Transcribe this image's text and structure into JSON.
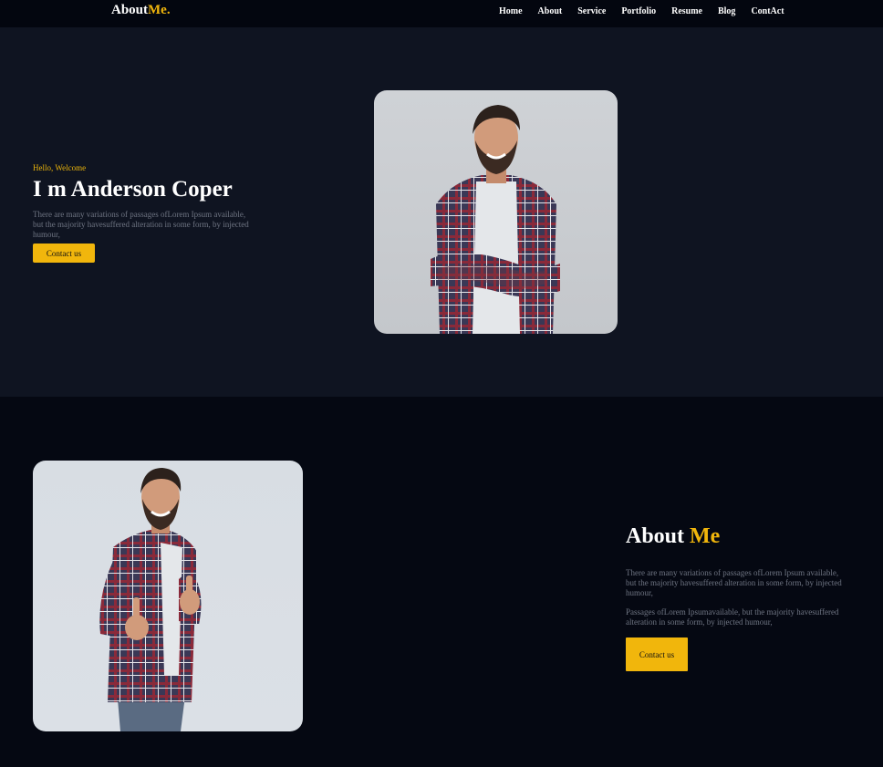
{
  "logo": {
    "main": "About",
    "accent": "Me."
  },
  "nav": [
    "Home",
    "About",
    "Service",
    "Portfolio",
    "Resume",
    "Blog",
    "ContAct"
  ],
  "hero": {
    "greeting": "Hello, Welcome",
    "title": "I m Anderson Coper",
    "description": "There are many variations of passages ofLorem Ipsum available, but the majority havesuffered alteration in some form, by injected humour,",
    "button": "Contact us"
  },
  "about": {
    "title_main": "About",
    "title_accent": "Me",
    "paragraph1": "There are many variations of passages ofLorem Ipsum available, but the majority havesuffered alteration in some form, by injected humour,",
    "paragraph2": "Passages ofLorem Ipsumavailable, but the majority havesuffered alteration in some form, by injected humour,",
    "button": "Contact us"
  },
  "colors": {
    "accent": "#f1b60c",
    "nav_bg": "#03060f",
    "hero_bg": "#0f1421",
    "page_bg": "#050812"
  },
  "icons": [
    "portrait-arms-crossed",
    "portrait-thumbs-up"
  ]
}
